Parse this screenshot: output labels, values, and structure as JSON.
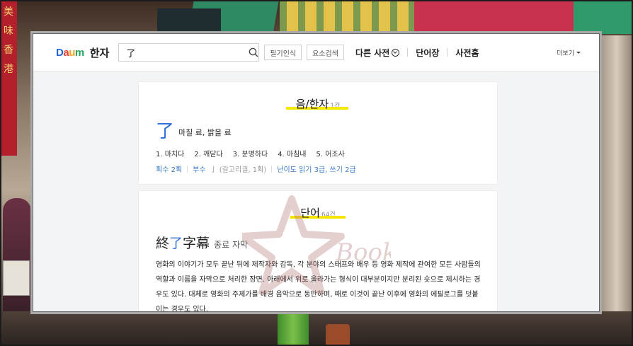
{
  "backdrop": {
    "banner_text": "美 味 香 港",
    "sign_text": "",
    "can_label": "",
    "box_label": ""
  },
  "header": {
    "logo_text": "Daum",
    "logo_letters": [
      "D",
      "a",
      "u",
      "m"
    ],
    "section_title": "한자",
    "search": {
      "value": "了",
      "placeholder": ""
    },
    "handwriting_button": "필기인식",
    "radical_search_button": "요소검색",
    "nav": [
      "다른 사전",
      "단어장",
      "사전홈"
    ],
    "more_label": "더보기"
  },
  "sound_section": {
    "title": "음/한자",
    "count": "1건",
    "entry": {
      "character": "了",
      "meaning": "마칠 료, 밝을 료",
      "meanings": [
        "1. 마치다",
        "2. 깨닫다",
        "3. 분명하다",
        "4. 마침내",
        "5. 어조사"
      ],
      "strokes_label": "획수 2획",
      "radical_label": "부수",
      "radical_value": "亅 (갈고리궐, 1획)",
      "level_label": "난이도 읽기 3급, 쓰기 2급"
    }
  },
  "word_section": {
    "title": "단어",
    "count": "64건",
    "entry": {
      "hanja_before": "終",
      "hanja_highlight": "了",
      "hanja_after": "字幕",
      "reading": "종료 자막",
      "description": "영화의 이야기가 모두 끝난 뒤에 제작자와 감독, 각 분야의 스태프와 배우 등 영화 제작에 관여한 모든 사람들의 역할과 이름을 자막으로 처리한 장면. 아래에서 위로 올라가는 형식이 대부분이지만 분리된 숏으로 제시하는 경우도 있다. 대체로 영화의 주제가를 배경 음악으로 동반하며, 때로 이것이 끝난 이후에 영화의 에필로그를 덧붙이는 경우도 있다."
    }
  },
  "watermark_text": "Book",
  "colors": {
    "accent_blue": "#2f6fd6",
    "highlight_yellow": "#f7e600",
    "daum_blue": "#1b66d3",
    "daum_red": "#ef3f2f",
    "daum_orange": "#f6a623",
    "daum_green": "#23a55e"
  }
}
